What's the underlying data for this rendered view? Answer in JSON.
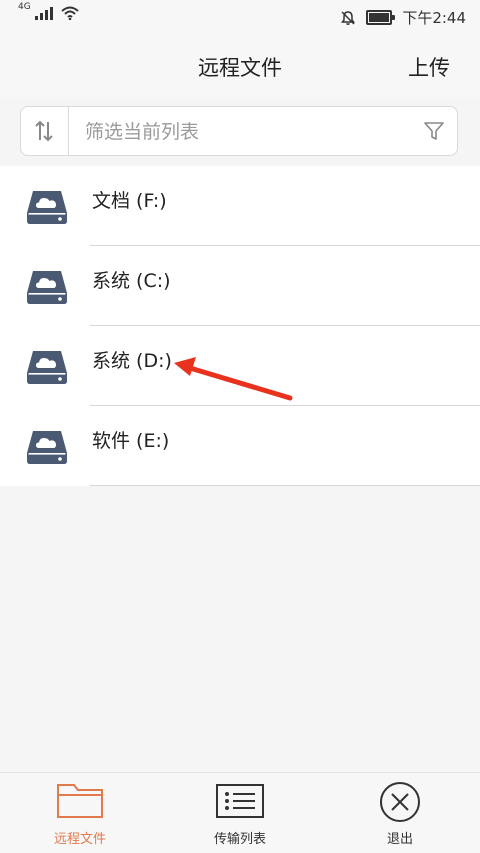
{
  "status_bar": {
    "network": "4G",
    "time": "下午2:44"
  },
  "header": {
    "title": "远程文件",
    "upload_label": "上传"
  },
  "filter": {
    "placeholder": "筛选当前列表"
  },
  "drives": [
    {
      "label": "文档 (F:)"
    },
    {
      "label": "系统 (C:)"
    },
    {
      "label": "系统 (D:)"
    },
    {
      "label": "软件 (E:)"
    }
  ],
  "tabs": [
    {
      "label": "远程文件",
      "icon": "folder-icon",
      "active": true
    },
    {
      "label": "传输列表",
      "icon": "list-icon",
      "active": false
    },
    {
      "label": "退出",
      "icon": "close-circle-icon",
      "active": false
    }
  ],
  "colors": {
    "accent": "#e07a4d",
    "drive_icon": "#4a5a73",
    "annotation_arrow": "#e8321e"
  }
}
